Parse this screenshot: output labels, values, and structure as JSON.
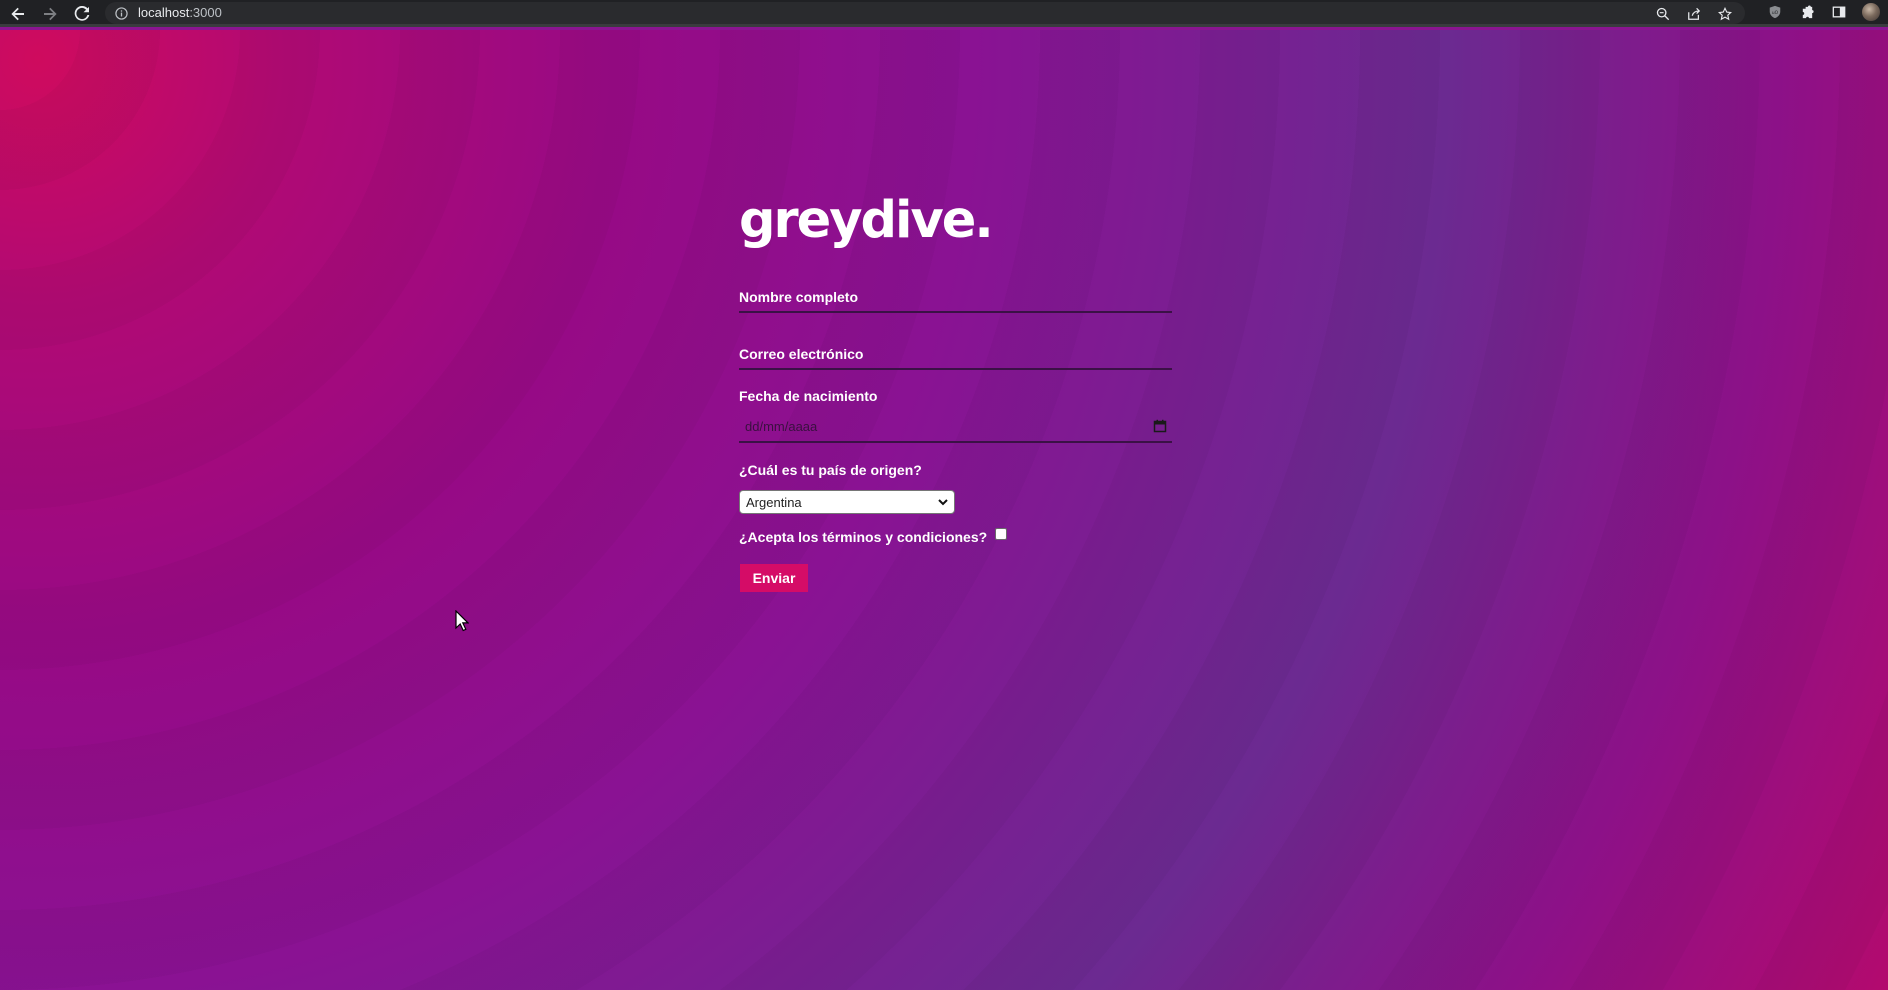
{
  "browser": {
    "url_host": "localhost",
    "url_port": ":3000",
    "icons": {
      "back": "back-arrow-icon",
      "forward": "forward-arrow-icon",
      "reload": "reload-icon",
      "info": "info-icon",
      "zoom": "zoom-icon",
      "share": "share-icon",
      "bookmark": "star-icon",
      "extension_shield": "shield-extension-icon",
      "extensions": "puzzle-icon",
      "side_panel": "side-panel-icon",
      "profile": "profile-avatar"
    }
  },
  "form": {
    "logo": "greydive.",
    "name_label": "Nombre completo",
    "email_label": "Correo electrónico",
    "birthdate_label": "Fecha de nacimiento",
    "birthdate_placeholder": "dd/mm/aaaa",
    "country_label": "¿Cuál es tu país de origen?",
    "country_selected": "Argentina",
    "terms_label": "¿Acepta los términos y condiciones?",
    "terms_checked": false,
    "submit_label": "Enviar"
  },
  "colors": {
    "button": "#d50c67",
    "background_primary": "#8a1293",
    "background_accent": "#cf0b5e"
  }
}
